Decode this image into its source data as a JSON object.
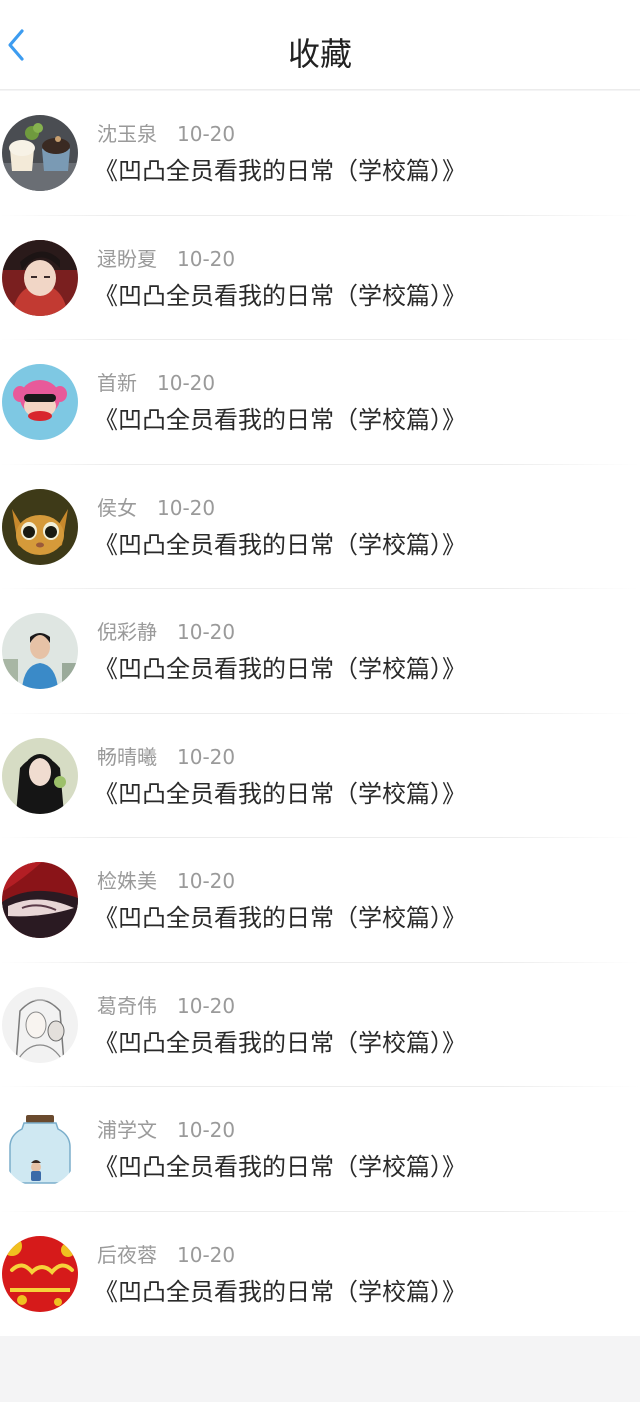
{
  "header": {
    "title": "收藏",
    "back_icon": "chevron-left-icon",
    "accent_color": "#3d9cf0"
  },
  "items": [
    {
      "name": "沈玉泉",
      "date": "10-20",
      "title": "《凹凸全员看我的日常（学校篇）》",
      "avatar": "cupcakes"
    },
    {
      "name": "逯盼夏",
      "date": "10-20",
      "title": "《凹凸全员看我的日常（学校篇）》",
      "avatar": "person-red"
    },
    {
      "name": "首新",
      "date": "10-20",
      "title": "《凹凸全员看我的日常（学校篇）》",
      "avatar": "cartoon-monkey"
    },
    {
      "name": "侯女",
      "date": "10-20",
      "title": "《凹凸全员看我的日常（学校篇）》",
      "avatar": "cat"
    },
    {
      "name": "倪彩静",
      "date": "10-20",
      "title": "《凹凸全员看我的日常（学校篇）》",
      "avatar": "boy-outdoor"
    },
    {
      "name": "畅晴曦",
      "date": "10-20",
      "title": "《凹凸全员看我的日常（学校篇）》",
      "avatar": "girl-dark-hair"
    },
    {
      "name": "检姝美",
      "date": "10-20",
      "title": "《凹凸全员看我的日常（学校篇）》",
      "avatar": "anime-red"
    },
    {
      "name": "葛奇伟",
      "date": "10-20",
      "title": "《凹凸全员看我的日常（学校篇）》",
      "avatar": "sketch-mask"
    },
    {
      "name": "浦学文",
      "date": "10-20",
      "title": "《凹凸全员看我的日常（学校篇）》",
      "avatar": "glass-jar"
    },
    {
      "name": "后夜蓉",
      "date": "10-20",
      "title": "《凹凸全员看我的日常（学校篇）》",
      "avatar": "new-year-red"
    }
  ]
}
